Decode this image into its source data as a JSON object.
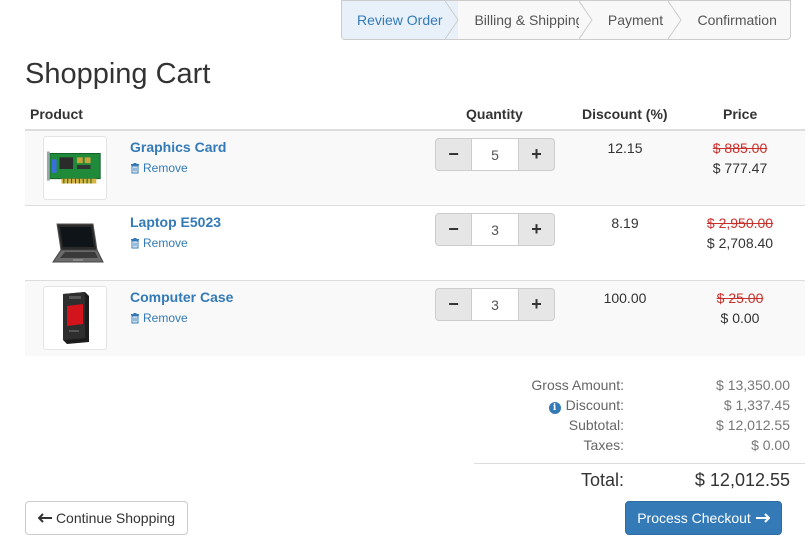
{
  "steps": [
    {
      "label": "Review Order",
      "active": true
    },
    {
      "label": "Billing & Shipping",
      "active": false
    },
    {
      "label": "Payment",
      "active": false
    },
    {
      "label": "Confirmation",
      "active": false
    }
  ],
  "page_title": "Shopping Cart",
  "table": {
    "headers": {
      "product": "Product",
      "quantity": "Quantity",
      "discount": "Discount (%)",
      "price": "Price"
    },
    "remove_label": "Remove",
    "items": [
      {
        "name": "Graphics Card",
        "quantity": "5",
        "discount": "12.15",
        "old_price": "$ 885.00",
        "new_price": "$ 777.47",
        "image": "graphics-card"
      },
      {
        "name": "Laptop E5023",
        "quantity": "3",
        "discount": "8.19",
        "old_price": "$ 2,950.00",
        "new_price": "$ 2,708.40",
        "image": "laptop"
      },
      {
        "name": "Computer Case",
        "quantity": "3",
        "discount": "100.00",
        "old_price": "$ 25.00",
        "new_price": "$ 0.00",
        "image": "computer-case"
      }
    ]
  },
  "summary": {
    "gross_label": "Gross Amount:",
    "gross_value": "$ 13,350.00",
    "discount_label": "Discount:",
    "discount_value": "$ 1,337.45",
    "subtotal_label": "Subtotal:",
    "subtotal_value": "$ 12,012.55",
    "taxes_label": "Taxes:",
    "taxes_value": "$ 0.00",
    "total_label": "Total:",
    "total_value": "$ 12,012.55"
  },
  "buttons": {
    "continue_label": "Continue Shopping",
    "checkout_label": "Process Checkout"
  },
  "icons": {
    "remove": "trash-icon",
    "discount_info": "info-icon",
    "continue": "arrow-left-icon",
    "checkout": "arrow-right-icon",
    "minus": "minus-icon",
    "plus": "plus-icon"
  },
  "colors": {
    "link": "#337ab7",
    "primary": "#337ab7",
    "strikethrough": "#c9302c",
    "active_step_bg": "#e8f0fa"
  }
}
